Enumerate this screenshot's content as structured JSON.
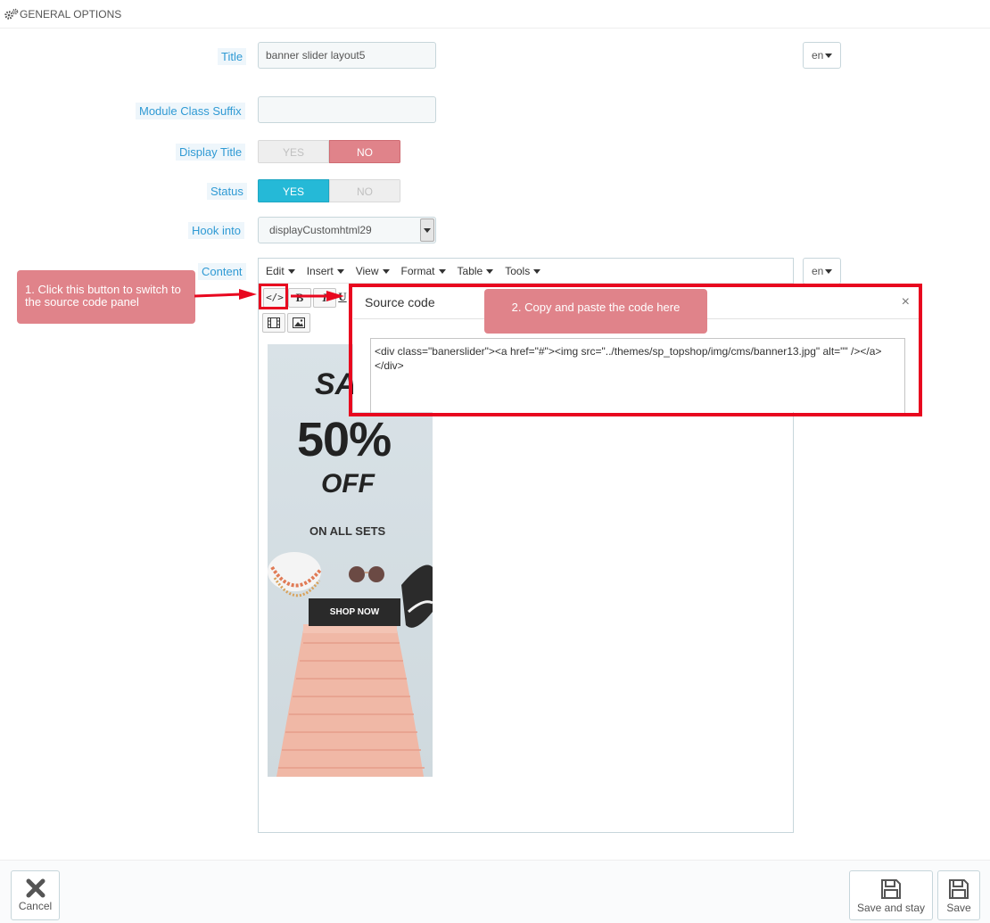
{
  "header": {
    "title": "GENERAL OPTIONS",
    "icon": "gears-icon"
  },
  "form": {
    "title_label": "Title",
    "title_value": "banner slider layout5",
    "lang": "en",
    "suffix_label": "Module Class Suffix",
    "suffix_value": "",
    "display_title_label": "Display Title",
    "display_title": {
      "yes": "YES",
      "no": "NO",
      "selected": "NO"
    },
    "status_label": "Status",
    "status": {
      "yes": "YES",
      "no": "NO",
      "selected": "YES"
    },
    "hook_label": "Hook into",
    "hook_value": "displayCustomhtml29",
    "content_label": "Content",
    "content_lang": "en"
  },
  "editor": {
    "menus": [
      "Edit",
      "Insert",
      "View",
      "Format",
      "Table",
      "Tools"
    ],
    "toolbar": {
      "source_icon": "</>",
      "bold": "B",
      "italic": "I",
      "underline": "U"
    }
  },
  "banner": {
    "sale": "SA",
    "percent": "50%",
    "off": "OFF",
    "sets": "ON ALL SETS",
    "cta": "SHOP NOW"
  },
  "annotations": {
    "step1": "1. Click this button to switch to the source code panel",
    "step2": "2. Copy and paste the code here",
    "highlight_color": "#e8071f",
    "callout_color": "#e0838a"
  },
  "source_modal": {
    "title": "Source code",
    "close": "×",
    "code": "<div class=\"banerslider\"><a href=\"#\"><img src=\"../themes/sp_topshop/img/cms/banner13.jpg\" alt=\"\" /></a></div>"
  },
  "footer": {
    "cancel": "Cancel",
    "save_stay": "Save and stay",
    "save": "Save"
  }
}
